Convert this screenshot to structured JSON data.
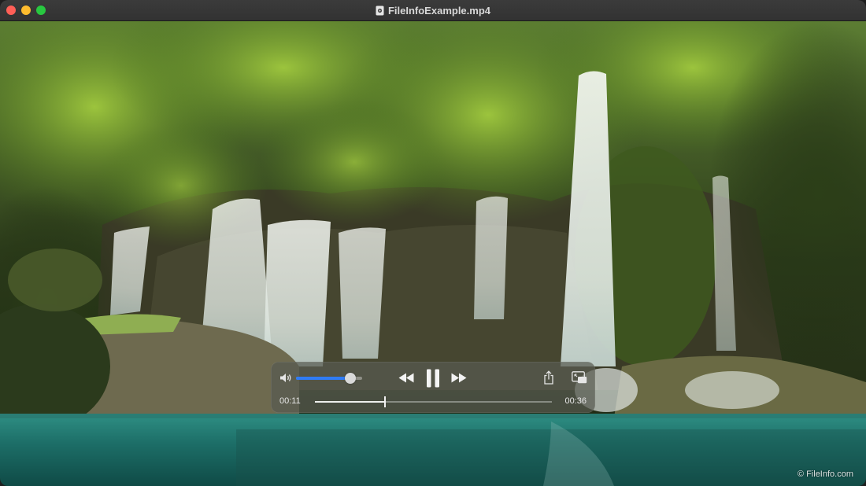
{
  "window": {
    "title": "FileInfoExample.mp4"
  },
  "video": {
    "watermark": "© FileInfo.com"
  },
  "controls": {
    "volume_level": 0.82,
    "current_time": "00:11",
    "duration": "00:36",
    "playback_progress": 0.297,
    "play_state": "playing",
    "buttons": {
      "rewind": "rewind-icon",
      "pause": "pause-icon",
      "fast_forward": "fast-forward-icon",
      "share": "share-icon",
      "picture_in_picture": "picture-in-picture-icon",
      "volume": "speaker-icon"
    }
  },
  "colors": {
    "accent": "#2f7cf6",
    "close": "#ff5f57",
    "minimize": "#febc2e",
    "maximize": "#28c840"
  }
}
